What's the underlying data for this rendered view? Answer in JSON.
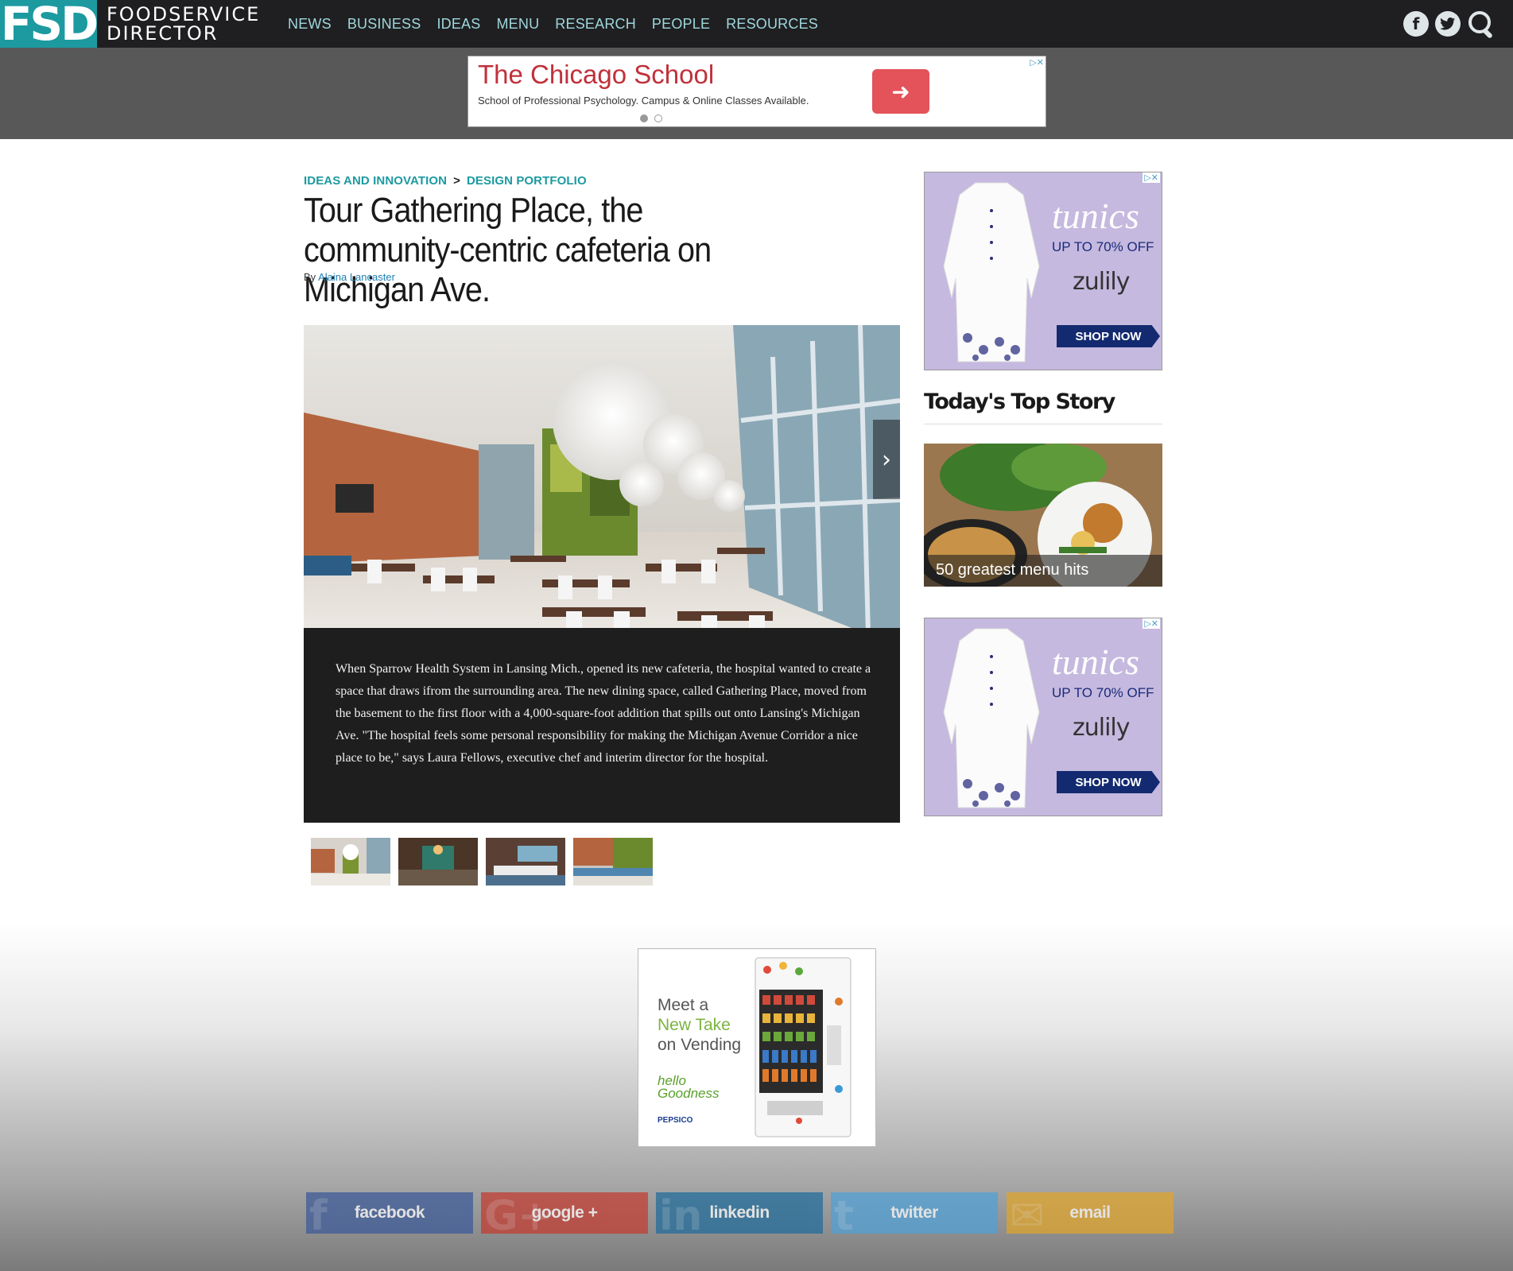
{
  "brand": {
    "logo_short": "FSD",
    "logo_line1": "FOODSERVICE",
    "logo_line2": "DIRECTOR"
  },
  "nav": {
    "items": [
      "NEWS",
      "BUSINESS",
      "IDEAS",
      "MENU",
      "RESEARCH",
      "PEOPLE",
      "RESOURCES"
    ]
  },
  "header_icons": [
    "facebook-icon",
    "twitter-icon",
    "search-icon"
  ],
  "top_ad": {
    "title": "The Chicago School",
    "subtitle": "School of Professional Psychology. Campus & Online Classes Available.",
    "button_arrow": "➜",
    "adchoices": "▷✕"
  },
  "breadcrumb": {
    "parent": "IDEAS AND INNOVATION",
    "separator": ">",
    "current": "DESIGN PORTFOLIO"
  },
  "article": {
    "title": "Tour Gathering Place, the community-centric cafeteria on Michigan Ave.",
    "by_prefix": "By",
    "author": "Alaina Lancaster"
  },
  "slideshow": {
    "next_arrow": "›",
    "caption": "When Sparrow Health System in Lansing Mich., opened its new cafeteria, the hospital wanted to create a space that draws ifrom the surrounding area. The new dining space, called Gathering Place, moved from the basement to the first floor with a 4,000-square-foot addition that spills out onto Lansing's Michigan Ave. \"The hospital feels some personal responsibility for making the Michigan Avenue Corridor a nice place to be,\" says Laura Fellows, executive chef and interim director for the hospital.",
    "thumbnail_count": 4
  },
  "side_ad": {
    "headline": "tunics",
    "offer": "UP TO 70% OFF",
    "brand": "zulily",
    "cta": "SHOP NOW",
    "adchoices": "▷✕"
  },
  "top_story": {
    "heading": "Today's Top Story",
    "card_label": "50 greatest menu hits"
  },
  "vending_ad": {
    "line1": "Meet a",
    "line2": "New Take",
    "line3": "on Vending",
    "hello1": "hello",
    "hello2": "Goodness",
    "sponsor": "PEPSICO"
  },
  "share": {
    "facebook": "facebook",
    "facebook_icon": "f",
    "google": "google +",
    "google_icon": "G+",
    "linkedin": "linkedin",
    "linkedin_icon": "in",
    "twitter": "twitter",
    "twitter_icon": "t",
    "email": "email",
    "email_icon": "✉"
  },
  "colors": {
    "brand_teal": "#1c9aa0",
    "topbar": "#1f1f21",
    "ad_red": "#c0313b",
    "zulily_purple": "#c5b9df"
  }
}
